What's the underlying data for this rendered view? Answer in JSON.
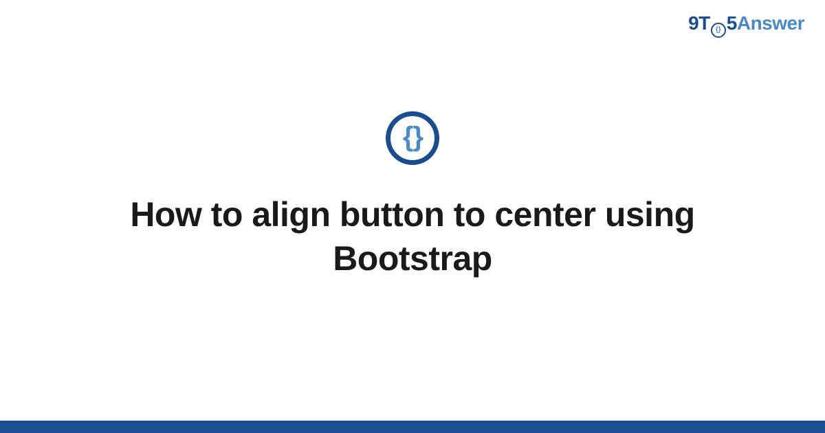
{
  "header": {
    "logo_part1": "9T",
    "logo_clock_inner": "{}",
    "logo_part2": "5",
    "logo_part3": "Answer"
  },
  "icon": {
    "glyph": "{ }"
  },
  "main": {
    "title": "How to align button to center using Bootstrap"
  },
  "colors": {
    "primary_dark": "#1a4d8f",
    "primary_light": "#4a89c7",
    "text": "#1a1a1a",
    "background": "#ffffff"
  }
}
